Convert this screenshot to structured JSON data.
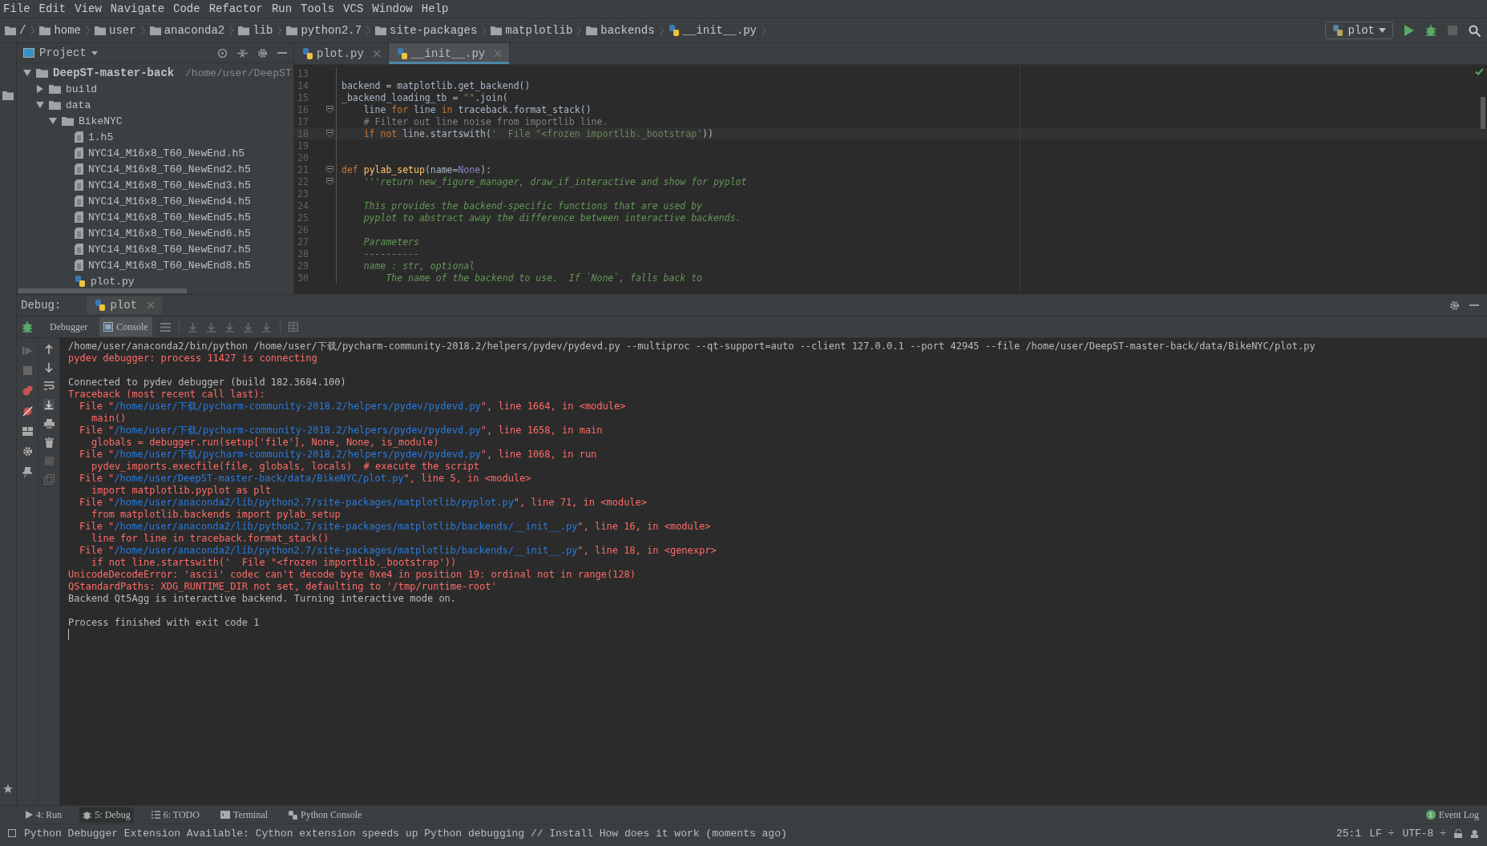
{
  "menu": [
    "File",
    "Edit",
    "View",
    "Navigate",
    "Code",
    "Refactor",
    "Run",
    "Tools",
    "VCS",
    "Window",
    "Help"
  ],
  "breadcrumb": [
    {
      "label": "/",
      "kind": "folder"
    },
    {
      "label": "home",
      "kind": "folder"
    },
    {
      "label": "user",
      "kind": "folder"
    },
    {
      "label": "anaconda2",
      "kind": "folder"
    },
    {
      "label": "lib",
      "kind": "folder"
    },
    {
      "label": "python2.7",
      "kind": "folder"
    },
    {
      "label": "site-packages",
      "kind": "folder"
    },
    {
      "label": "matplotlib",
      "kind": "folder"
    },
    {
      "label": "backends",
      "kind": "folder"
    },
    {
      "label": "__init__.py",
      "kind": "python"
    }
  ],
  "run_config": {
    "label": "plot"
  },
  "project": {
    "title": "Project",
    "tree": [
      {
        "label": "DeepST-master-back",
        "path": "/home/user/DeepST",
        "kind": "folder",
        "expanded": true,
        "children": [
          {
            "label": "build",
            "kind": "folder",
            "expanded": false
          },
          {
            "label": "data",
            "kind": "folder",
            "expanded": true,
            "children": [
              {
                "label": "BikeNYC",
                "kind": "folder",
                "expanded": true,
                "children": [
                  {
                    "label": "1.h5",
                    "kind": "file"
                  },
                  {
                    "label": "NYC14_M16x8_T60_NewEnd.h5",
                    "kind": "file"
                  },
                  {
                    "label": "NYC14_M16x8_T60_NewEnd2.h5",
                    "kind": "file"
                  },
                  {
                    "label": "NYC14_M16x8_T60_NewEnd3.h5",
                    "kind": "file"
                  },
                  {
                    "label": "NYC14_M16x8_T60_NewEnd4.h5",
                    "kind": "file"
                  },
                  {
                    "label": "NYC14_M16x8_T60_NewEnd5.h5",
                    "kind": "file"
                  },
                  {
                    "label": "NYC14_M16x8_T60_NewEnd6.h5",
                    "kind": "file"
                  },
                  {
                    "label": "NYC14_M16x8_T60_NewEnd7.h5",
                    "kind": "file"
                  },
                  {
                    "label": "NYC14_M16x8_T60_NewEnd8.h5",
                    "kind": "file"
                  },
                  {
                    "label": "plot.py",
                    "kind": "python"
                  }
                ]
              }
            ]
          }
        ]
      }
    ]
  },
  "editor": {
    "tabs": [
      {
        "label": "plot.py",
        "selected": false
      },
      {
        "label": "__init__.py",
        "selected": true
      }
    ],
    "lines": [
      {
        "number": "13",
        "fold": false,
        "current": false
      },
      {
        "number": "14",
        "fold": false,
        "current": false,
        "tokens": [
          {
            "kind": "plain",
            "text": "backend = matplotlib.get_backend()"
          }
        ]
      },
      {
        "number": "15",
        "fold": false,
        "current": false,
        "tokens": [
          {
            "kind": "plain",
            "text": "_backend_loading_tb = "
          },
          {
            "kind": "string",
            "text": "\"\""
          },
          {
            "kind": "plain",
            "text": ".join("
          }
        ]
      },
      {
        "number": "16",
        "fold": true,
        "current": false,
        "tokens": [
          {
            "kind": "plain",
            "text": "    line "
          },
          {
            "kind": "keyword",
            "text": "for"
          },
          {
            "kind": "plain",
            "text": " line "
          },
          {
            "kind": "keyword",
            "text": "in"
          },
          {
            "kind": "plain",
            "text": " traceback.format_stack()"
          }
        ]
      },
      {
        "number": "17",
        "fold": false,
        "current": false,
        "tokens": [
          {
            "kind": "comment",
            "text": "    # Filter out line noise from importlib line."
          }
        ]
      },
      {
        "number": "18",
        "fold": true,
        "current": true,
        "tokens": [
          {
            "kind": "keyword",
            "text": "    if not"
          },
          {
            "kind": "plain",
            "text": " line.startswith("
          },
          {
            "kind": "string",
            "text": "'  File \"<frozen importlib._bootstrap'"
          },
          {
            "kind": "plain",
            "text": "))"
          }
        ]
      },
      {
        "number": "19",
        "fold": false,
        "current": false
      },
      {
        "number": "20",
        "fold": false,
        "current": false
      },
      {
        "number": "21",
        "fold": true,
        "current": false,
        "tokens": [
          {
            "kind": "keyword",
            "text": "def "
          },
          {
            "kind": "func",
            "text": "pylab_setup"
          },
          {
            "kind": "plain",
            "text": "(name="
          },
          {
            "kind": "builtin",
            "text": "None"
          },
          {
            "kind": "plain",
            "text": "):"
          }
        ]
      },
      {
        "number": "22",
        "fold": true,
        "current": false,
        "tokens": [
          {
            "kind": "doc",
            "text": "    '''return new_figure_manager, draw_if_interactive and show for pyplot"
          }
        ]
      },
      {
        "number": "23",
        "fold": false,
        "current": false
      },
      {
        "number": "24",
        "fold": false,
        "current": false,
        "tokens": [
          {
            "kind": "doc",
            "text": "    This provides the backend-specific functions that are used by"
          }
        ]
      },
      {
        "number": "25",
        "fold": false,
        "current": false,
        "tokens": [
          {
            "kind": "doc",
            "text": "    pyplot to abstract away the difference between interactive backends."
          }
        ]
      },
      {
        "number": "26",
        "fold": false,
        "current": false
      },
      {
        "number": "27",
        "fold": false,
        "current": false,
        "tokens": [
          {
            "kind": "doc",
            "text": "    Parameters"
          }
        ]
      },
      {
        "number": "28",
        "fold": false,
        "current": false,
        "tokens": [
          {
            "kind": "doc",
            "text": "    ----------"
          }
        ]
      },
      {
        "number": "29",
        "fold": false,
        "current": false,
        "tokens": [
          {
            "kind": "doc",
            "text": "    name : str, optional"
          }
        ]
      },
      {
        "number": "30",
        "fold": false,
        "current": false,
        "tokens": [
          {
            "kind": "doc",
            "text": "        The name of the backend to use.  If `None`, falls back to"
          }
        ]
      }
    ]
  },
  "debug": {
    "label": "Debug:",
    "session": "plot",
    "tabs": [
      {
        "label": "Debugger",
        "selected": false
      },
      {
        "label": "Console",
        "selected": true
      }
    ],
    "console": [
      {
        "kind": "plain",
        "text": "/home/user/anaconda2/bin/python /home/user/下载/pycharm-community-2018.2/helpers/pydev/pydevd.py --multiproc --qt-support=auto --client 127.0.0.1 --port 42945 --file /home/user/DeepST-master-back/data/BikeNYC/plot.py"
      },
      {
        "kind": "error",
        "text": "pydev debugger: process 11427 is connecting"
      },
      {
        "kind": "blank"
      },
      {
        "kind": "plain",
        "text": "Connected to pydev debugger (build 182.3684.100)"
      },
      {
        "kind": "error",
        "text": "Traceback (most recent call last):"
      },
      {
        "kind": "file",
        "lead": "File \"",
        "link": "/home/user/下载/pycharm-community-2018.2/helpers/pydev/pydevd.py",
        "tail": "\", line 1664, in <module>"
      },
      {
        "kind": "source",
        "text": "main()"
      },
      {
        "kind": "file",
        "lead": "File \"",
        "link": "/home/user/下载/pycharm-community-2018.2/helpers/pydev/pydevd.py",
        "tail": "\", line 1658, in main"
      },
      {
        "kind": "source",
        "text": "globals = debugger.run(setup['file'], None, None, is_module)"
      },
      {
        "kind": "file",
        "lead": "File \"",
        "link": "/home/user/下载/pycharm-community-2018.2/helpers/pydev/pydevd.py",
        "tail": "\", line 1068, in run"
      },
      {
        "kind": "source",
        "text": "pydev_imports.execfile(file, globals, locals)  # execute the script"
      },
      {
        "kind": "file",
        "lead": "File \"",
        "link": "/home/user/DeepST-master-back/data/BikeNYC/plot.py",
        "tail": "\", line 5, in <module>"
      },
      {
        "kind": "source",
        "text": "import matplotlib.pyplot as plt"
      },
      {
        "kind": "file",
        "lead": "File \"",
        "link": "/home/user/anaconda2/lib/python2.7/site-packages/matplotlib/pyplot.py",
        "tail": "\", line 71, in <module>"
      },
      {
        "kind": "source",
        "text": "from matplotlib.backends import pylab_setup"
      },
      {
        "kind": "file",
        "lead": "File \"",
        "link": "/home/user/anaconda2/lib/python2.7/site-packages/matplotlib/backends/__init__.py",
        "tail": "\", line 16, in <module>"
      },
      {
        "kind": "source",
        "text": "line for line in traceback.format_stack()"
      },
      {
        "kind": "file",
        "lead": "File \"",
        "link": "/home/user/anaconda2/lib/python2.7/site-packages/matplotlib/backends/__init__.py",
        "tail": "\", line 18, in <genexpr>"
      },
      {
        "kind": "source",
        "text": "if not line.startswith('  File \"<frozen importlib._bootstrap'))"
      },
      {
        "kind": "error",
        "text": "UnicodeDecodeError: 'ascii' codec can't decode byte 0xe4 in position 19: ordinal not in range(128)"
      },
      {
        "kind": "error",
        "text": "QStandardPaths: XDG_RUNTIME_DIR not set, defaulting to '/tmp/runtime-root'"
      },
      {
        "kind": "plain",
        "text": "Backend Qt5Agg is interactive backend. Turning interactive mode on."
      },
      {
        "kind": "blank"
      },
      {
        "kind": "plain",
        "text": "Process finished with exit code 1"
      }
    ]
  },
  "tool_windows": [
    {
      "label": "4: Run",
      "kind": "run",
      "selected": false
    },
    {
      "label": "5: Debug",
      "kind": "debug",
      "selected": true
    },
    {
      "label": "6: TODO",
      "kind": "todo",
      "selected": false
    },
    {
      "label": "Terminal",
      "kind": "terminal",
      "selected": false
    },
    {
      "label": "Python Console",
      "kind": "python",
      "selected": false
    }
  ],
  "event_log": {
    "label": "Event Log",
    "count": "1"
  },
  "status_bar": {
    "message": "Python Debugger Extension Available: Cython extension speeds up Python debugging // Install How does it work (moments ago)",
    "position": "25:1",
    "line_sep": "LF ÷",
    "encoding": "UTF-8 ÷"
  }
}
